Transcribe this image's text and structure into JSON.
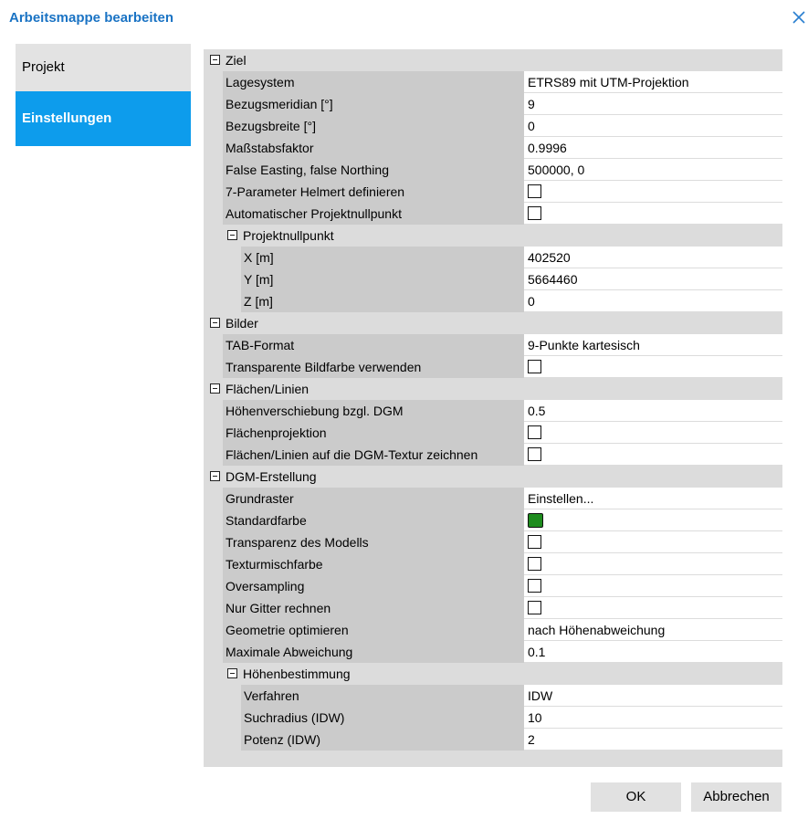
{
  "dialog": {
    "title": "Arbeitsmappe bearbeiten"
  },
  "nav": [
    {
      "label": "Projekt",
      "active": false
    },
    {
      "label": "Einstellungen",
      "active": true
    }
  ],
  "grid": {
    "rows": [
      {
        "kind": "section",
        "level": 0,
        "label": "Ziel"
      },
      {
        "kind": "prop",
        "level": 1,
        "label": "Lagesystem",
        "value": "ETRS89 mit UTM-Projektion"
      },
      {
        "kind": "prop",
        "level": 1,
        "label": "Bezugsmeridian [°]",
        "value": "9"
      },
      {
        "kind": "prop",
        "level": 1,
        "label": "Bezugsbreite [°]",
        "value": "0"
      },
      {
        "kind": "prop",
        "level": 1,
        "label": "Maßstabsfaktor",
        "value": "0.9996"
      },
      {
        "kind": "prop",
        "level": 1,
        "label": "False Easting, false Northing",
        "value": "500000, 0"
      },
      {
        "kind": "prop",
        "level": 1,
        "label": "7-Parameter Helmert definieren",
        "type": "checkbox",
        "checked": false
      },
      {
        "kind": "prop",
        "level": 1,
        "label": "Automatischer Projektnullpunkt",
        "type": "checkbox",
        "checked": false
      },
      {
        "kind": "section",
        "level": 1,
        "label": "Projektnullpunkt"
      },
      {
        "kind": "prop",
        "level": 2,
        "label": "X [m]",
        "value": "402520"
      },
      {
        "kind": "prop",
        "level": 2,
        "label": "Y [m]",
        "value": "5664460"
      },
      {
        "kind": "prop",
        "level": 2,
        "label": "Z [m]",
        "value": "0"
      },
      {
        "kind": "section",
        "level": 0,
        "label": "Bilder"
      },
      {
        "kind": "prop",
        "level": 1,
        "label": "TAB-Format",
        "value": "9-Punkte kartesisch"
      },
      {
        "kind": "prop",
        "level": 1,
        "label": "Transparente Bildfarbe verwenden",
        "type": "checkbox",
        "checked": false
      },
      {
        "kind": "section",
        "level": 0,
        "label": "Flächen/Linien"
      },
      {
        "kind": "prop",
        "level": 1,
        "label": "Höhenverschiebung bzgl. DGM",
        "value": "0.5"
      },
      {
        "kind": "prop",
        "level": 1,
        "label": "Flächenprojektion",
        "type": "checkbox",
        "checked": false
      },
      {
        "kind": "prop",
        "level": 1,
        "label": "Flächen/Linien auf die DGM-Textur zeichnen",
        "type": "checkbox",
        "checked": false
      },
      {
        "kind": "section",
        "level": 0,
        "label": "DGM-Erstellung"
      },
      {
        "kind": "prop",
        "level": 1,
        "label": "Grundraster",
        "value": "Einstellen..."
      },
      {
        "kind": "prop",
        "level": 1,
        "label": "Standardfarbe",
        "type": "color",
        "color": "#1e8c1e"
      },
      {
        "kind": "prop",
        "level": 1,
        "label": "Transparenz des Modells",
        "type": "checkbox",
        "checked": false
      },
      {
        "kind": "prop",
        "level": 1,
        "label": "Texturmischfarbe",
        "type": "checkbox",
        "checked": false
      },
      {
        "kind": "prop",
        "level": 1,
        "label": "Oversampling",
        "type": "checkbox",
        "checked": false
      },
      {
        "kind": "prop",
        "level": 1,
        "label": "Nur Gitter rechnen",
        "type": "checkbox",
        "checked": false
      },
      {
        "kind": "prop",
        "level": 1,
        "label": "Geometrie optimieren",
        "value": "nach Höhenabweichung"
      },
      {
        "kind": "prop",
        "level": 1,
        "label": "Maximale Abweichung",
        "value": "0.1"
      },
      {
        "kind": "section",
        "level": 1,
        "label": "Höhenbestimmung"
      },
      {
        "kind": "prop",
        "level": 2,
        "label": "Verfahren",
        "value": "IDW"
      },
      {
        "kind": "prop",
        "level": 2,
        "label": "Suchradius (IDW)",
        "value": "10"
      },
      {
        "kind": "prop",
        "level": 2,
        "label": "Potenz (IDW)",
        "value": "2"
      }
    ]
  },
  "buttons": {
    "ok": "OK",
    "cancel": "Abbrechen"
  },
  "colors": {
    "title": "#1a73c4",
    "nav_active": "#0d9cec",
    "swatch": "#1e8c1e"
  }
}
